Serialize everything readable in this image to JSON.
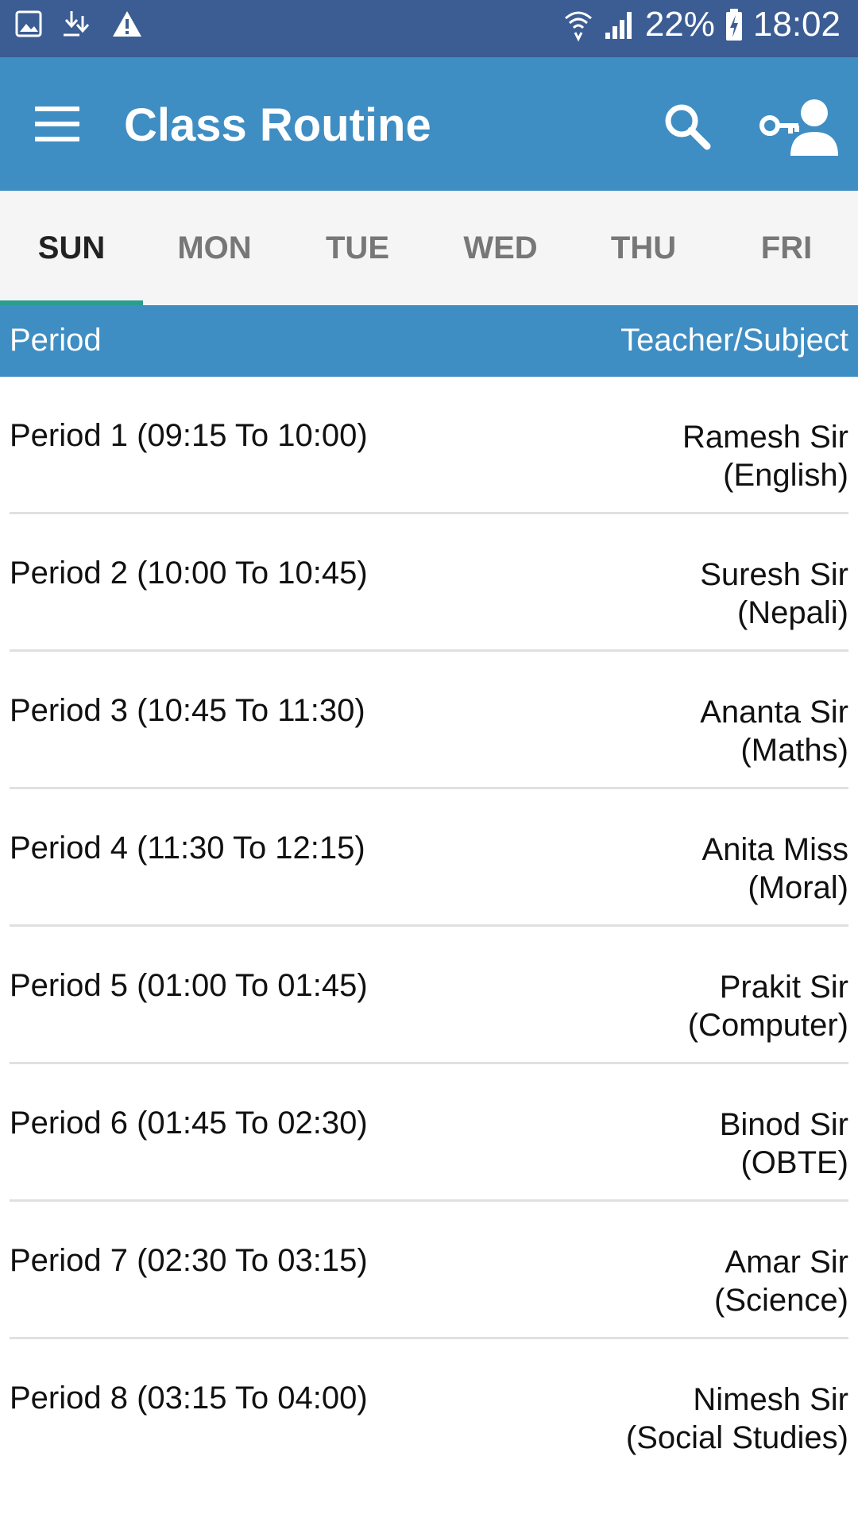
{
  "status_bar": {
    "icons_left": [
      "image-icon",
      "download-icon",
      "warning-icon"
    ],
    "icons_right": [
      "wifi-icon",
      "signal-icon",
      "battery-charging-icon"
    ],
    "battery": "22%",
    "time": "18:02"
  },
  "app_bar": {
    "title": "Class Routine",
    "menu_icon": "hamburger-menu-icon",
    "search_icon": "search-icon",
    "account_icon": "account-key-icon"
  },
  "tabs": [
    {
      "label": "SUN",
      "active": true
    },
    {
      "label": "MON",
      "active": false
    },
    {
      "label": "TUE",
      "active": false
    },
    {
      "label": "WED",
      "active": false
    },
    {
      "label": "THU",
      "active": false
    },
    {
      "label": "FRI",
      "active": false
    }
  ],
  "table": {
    "header_left": "Period",
    "header_right": "Teacher/Subject",
    "rows": [
      {
        "period": "Period 1 (09:15  To  10:00)",
        "teacher": "Ramesh Sir",
        "subject": "(English)"
      },
      {
        "period": "Period 2 (10:00  To  10:45)",
        "teacher": "Suresh Sir",
        "subject": "(Nepali)"
      },
      {
        "period": "Period 3 (10:45  To  11:30)",
        "teacher": "Ananta Sir",
        "subject": "(Maths)"
      },
      {
        "period": "Period 4 (11:30  To  12:15)",
        "teacher": "Anita Miss",
        "subject": "(Moral)"
      },
      {
        "period": "Period 5 (01:00  To  01:45)",
        "teacher": "Prakit Sir",
        "subject": "(Computer)"
      },
      {
        "period": "Period 6 (01:45  To  02:30)",
        "teacher": "Binod Sir",
        "subject": "(OBTE)"
      },
      {
        "period": "Period 7 (02:30  To  03:15)",
        "teacher": "Amar Sir",
        "subject": "(Science)"
      },
      {
        "period": "Period 8 (03:15  To  04:00)",
        "teacher": "Nimesh Sir",
        "subject": "(Social Studies)"
      }
    ]
  },
  "colors": {
    "status_bar": "#3c5d93",
    "primary": "#3e8ec4",
    "tab_indicator": "#2a9d8f",
    "tab_background": "#f5f5f5"
  }
}
